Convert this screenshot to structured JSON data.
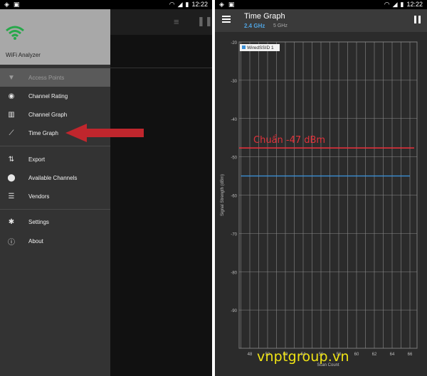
{
  "status": {
    "time": "12:22"
  },
  "left": {
    "drawer_title": "WiFi Analyzer",
    "nav": [
      {
        "label": "Access Points",
        "icon": "wifi-icon"
      },
      {
        "label": "Channel Rating",
        "icon": "rating-icon"
      },
      {
        "label": "Channel Graph",
        "icon": "bar-chart-icon"
      },
      {
        "label": "Time Graph",
        "icon": "line-chart-icon"
      },
      {
        "label": "Export",
        "icon": "export-icon"
      },
      {
        "label": "Available Channels",
        "icon": "location-pin-icon"
      },
      {
        "label": "Vendors",
        "icon": "list-icon"
      },
      {
        "label": "Settings",
        "icon": "gear-icon"
      },
      {
        "label": "About",
        "icon": "info-icon"
      }
    ],
    "active_index": 0,
    "arrow_color": "#c0262d"
  },
  "right": {
    "title": "Time Graph",
    "tabs": [
      "2.4 GHz",
      "5 GHz"
    ],
    "accent": "#4fa3e0",
    "watermark": "vnptgroup.vn"
  },
  "chart_data": {
    "type": "line",
    "title": "",
    "xlabel": "Scan Count",
    "ylabel": "Signal Strength (dBm)",
    "xlim": [
      46.8,
      66.8
    ],
    "ylim": [
      -100,
      -20
    ],
    "x_ticks": [
      48,
      50,
      52,
      54,
      56,
      58,
      60,
      62,
      64,
      66
    ],
    "y_ticks": [
      -20,
      -30,
      -40,
      -50,
      -60,
      -70,
      -80,
      -90
    ],
    "grid": true,
    "legend": "top-left",
    "series": [
      {
        "name": "WiredSSID 1",
        "color": "#3b8fd6",
        "x": [
          47,
          66
        ],
        "y": [
          -55,
          -55
        ]
      }
    ],
    "annotations": [
      {
        "text": "Chuẩn -47 dBm",
        "y": -47.7,
        "color": "#e0313a"
      }
    ]
  }
}
